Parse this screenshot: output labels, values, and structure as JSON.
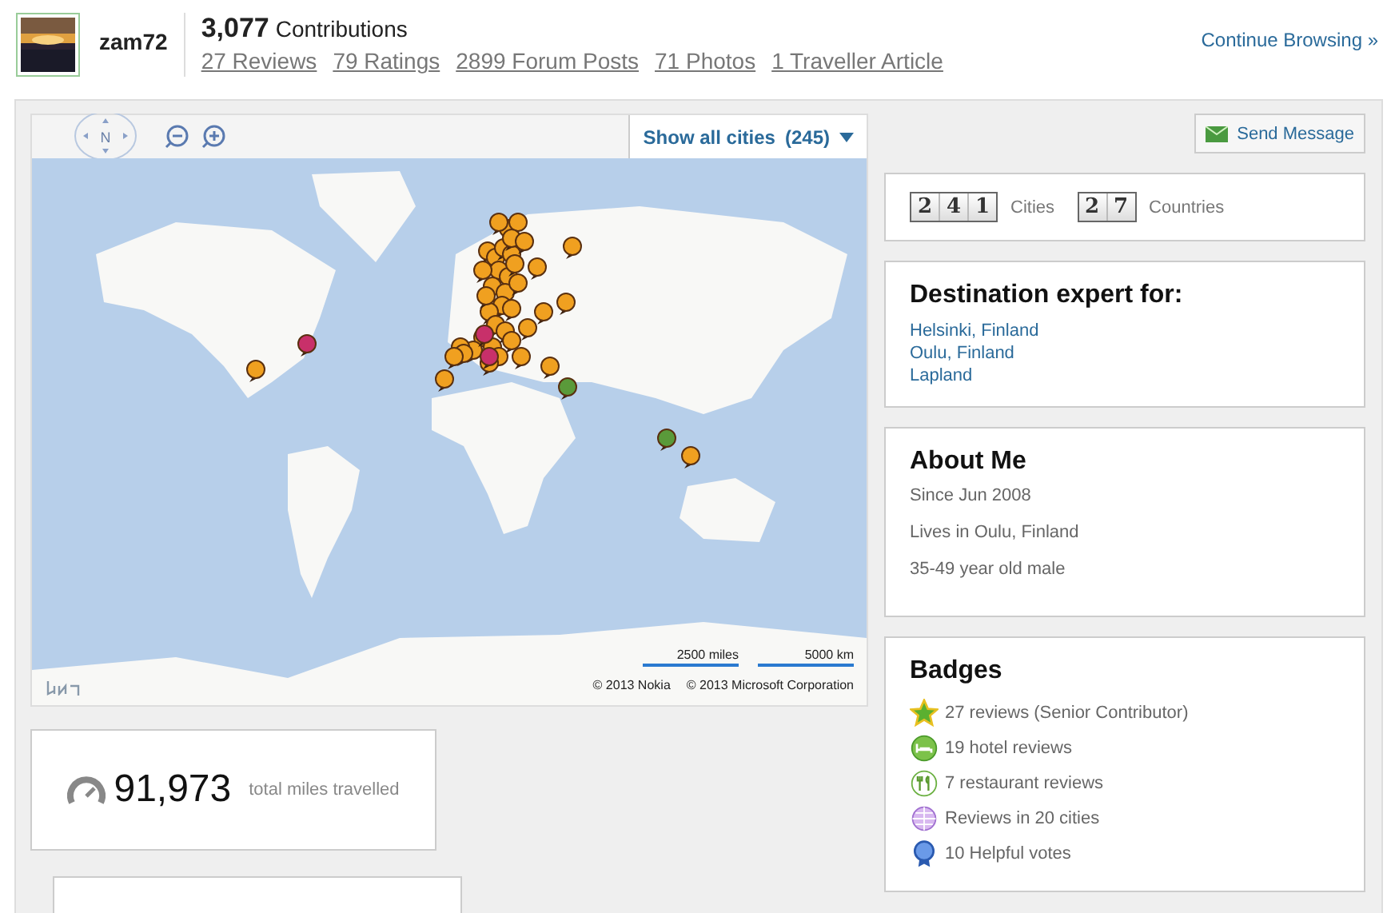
{
  "profile": {
    "username": "zam72",
    "contributions_count": "3,077",
    "contributions_label": "Contributions",
    "links": [
      "27 Reviews",
      "79 Ratings",
      "2899 Forum Posts",
      "71 Photos",
      "1 Traveller Article"
    ],
    "continue_link": "Continue Browsing »"
  },
  "map": {
    "compass_label": "N",
    "filter": {
      "label": "Show all cities",
      "count": "(245)"
    },
    "scale": [
      "2500 miles",
      "5000 km"
    ],
    "copyright": [
      "© 2013 Nokia",
      "© 2013 Microsoft Corporation"
    ]
  },
  "miles": {
    "value": "91,973",
    "label": "total miles travelled"
  },
  "send_button": "Send Message",
  "counters": [
    {
      "digits": [
        "2",
        "4",
        "1"
      ],
      "label": "Cities"
    },
    {
      "digits": [
        "2",
        "7"
      ],
      "label": "Countries"
    }
  ],
  "expert": {
    "title": "Destination expert for:",
    "places": [
      "Helsinki, Finland",
      "Oulu, Finland",
      "Lapland"
    ]
  },
  "about": {
    "title": "About Me",
    "lines": [
      "Since Jun 2008",
      "Lives in Oulu, Finland",
      "35-49 year old male"
    ]
  },
  "badges": {
    "title": "Badges",
    "items": [
      {
        "kind": "star",
        "text": "27 reviews (Senior Contributor)"
      },
      {
        "kind": "hotel",
        "text": "19 hotel reviews"
      },
      {
        "kind": "restaurant",
        "text": "7 restaurant reviews"
      },
      {
        "kind": "globe",
        "text": "Reviews in 20 cities"
      },
      {
        "kind": "ribbon",
        "text": "10 Helpful votes"
      }
    ]
  }
}
